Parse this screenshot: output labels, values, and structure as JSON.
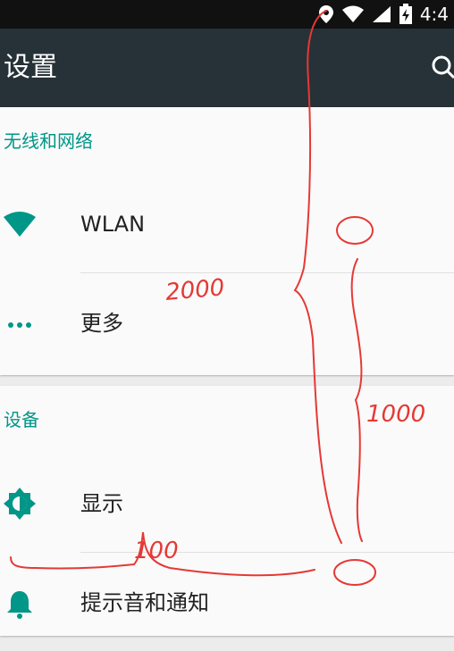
{
  "status_bar": {
    "time": "4:4"
  },
  "app_bar": {
    "title": "设置"
  },
  "sections": [
    {
      "header": "无线和网络",
      "items": [
        {
          "label": "WLAN"
        },
        {
          "label": "更多"
        }
      ]
    },
    {
      "header": "设备",
      "items": [
        {
          "label": "显示"
        },
        {
          "label": "提示音和通知"
        }
      ]
    }
  ],
  "annotations": {
    "label_2000": "2000",
    "label_1000": "1000",
    "label_100": "100"
  },
  "colors": {
    "accent": "#009688",
    "appbar": "#263238",
    "annotation": "#e53935"
  }
}
